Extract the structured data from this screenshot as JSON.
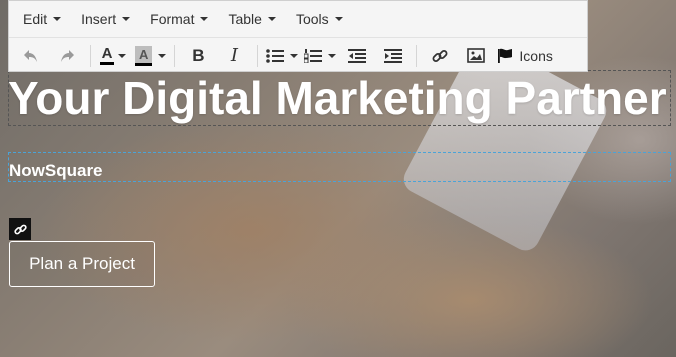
{
  "menubar": {
    "items": [
      {
        "label": "Edit"
      },
      {
        "label": "Insert"
      },
      {
        "label": "Format"
      },
      {
        "label": "Table"
      },
      {
        "label": "Tools"
      }
    ]
  },
  "toolbar": {
    "forecolor_glyph": "A",
    "backcolor_glyph": "A",
    "bold_glyph": "B",
    "italic_glyph": "I",
    "icons_label": "Icons"
  },
  "content": {
    "title": "Your Digital Marketing Partner",
    "subtitle": "NowSquare",
    "cta_label": "Plan a Project"
  }
}
